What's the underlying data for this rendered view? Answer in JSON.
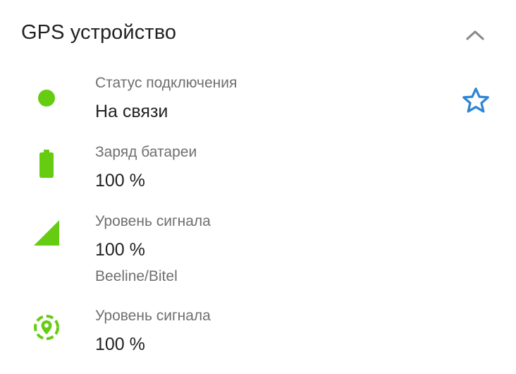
{
  "header": {
    "title": "GPS устройство",
    "collapse_icon": "chevron-up-icon"
  },
  "favorite_icon": "star-outline-icon",
  "colors": {
    "accent_green": "#66cc11",
    "star_blue": "#2f86d6",
    "label_gray": "#6f6f6f",
    "text_dark": "#222222"
  },
  "rows": [
    {
      "icon": "status-dot-icon",
      "label": "Статус подключения",
      "value": "На связи"
    },
    {
      "icon": "battery-icon",
      "label": "Заряд батареи",
      "value": "100 %"
    },
    {
      "icon": "cellular-signal-icon",
      "label": "Уровень сигнала",
      "value": "100 %",
      "sub": "Beeline/Bitel"
    },
    {
      "icon": "gps-signal-icon",
      "label": "Уровень сигнала",
      "value": "100 %"
    }
  ]
}
